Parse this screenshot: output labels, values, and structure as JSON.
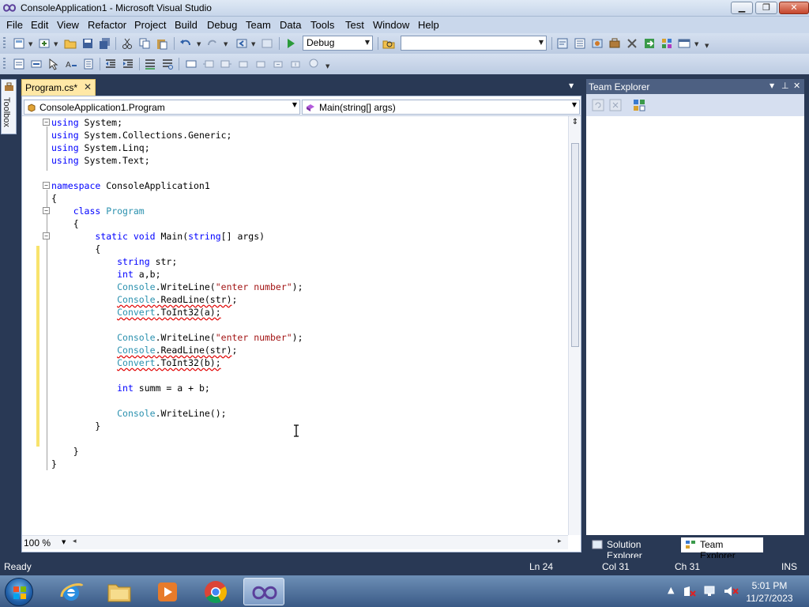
{
  "window": {
    "title": "ConsoleApplication1 - Microsoft Visual Studio",
    "minimize": "▁",
    "maximize": "❐",
    "close": "✕"
  },
  "menu": [
    "File",
    "Edit",
    "View",
    "Refactor",
    "Project",
    "Build",
    "Debug",
    "Team",
    "Data",
    "Tools",
    "Test",
    "Window",
    "Help"
  ],
  "toolbar": {
    "config_value": "Debug",
    "platform_value": ""
  },
  "toolbox_label": "Toolbox",
  "doc_tab": {
    "label": "Program.cs*",
    "close": "✕"
  },
  "nav": {
    "type_value": "ConsoleApplication1.Program",
    "member_value": "Main(string[] args)"
  },
  "code": {
    "l1": [
      "using",
      " System;"
    ],
    "l2": [
      "using",
      " System.Collections.Generic;"
    ],
    "l3": [
      "using",
      " System.Linq;"
    ],
    "l4": [
      "using",
      " System.Text;"
    ],
    "l6": [
      "namespace",
      " ConsoleApplication1"
    ],
    "l7": "{",
    "l8": [
      "    ",
      "class",
      " ",
      "Program"
    ],
    "l9": "    {",
    "l10": [
      "        ",
      "static",
      " ",
      "void",
      " Main(",
      "string",
      "[] args)"
    ],
    "l11": "        {",
    "l12": [
      "            ",
      "string",
      " str;"
    ],
    "l13": [
      "            ",
      "int",
      " a,b;"
    ],
    "l14": [
      "            ",
      "Console",
      ".WriteLine(",
      "\"enter number\"",
      ");"
    ],
    "l15": [
      "            ",
      "Console",
      ".ReadLine(str)",
      ";"
    ],
    "l16": [
      "            ",
      "Convert",
      ".ToInt32(a);"
    ],
    "l18": [
      "            ",
      "Console",
      ".WriteLine(",
      "\"enter number\"",
      ");"
    ],
    "l19": [
      "            ",
      "Console",
      ".ReadLine(str)",
      ";"
    ],
    "l20": [
      "            ",
      "Convert",
      ".ToInt32(b);"
    ],
    "l22": [
      "            ",
      "int",
      " summ = a + b;"
    ],
    "l24": [
      "            ",
      "Console",
      ".WriteLine();"
    ],
    "l25": "        }",
    "l27": "    }",
    "l28": "}"
  },
  "editor": {
    "zoom": "100 %"
  },
  "team_explorer": {
    "title": "Team Explorer"
  },
  "bottom_tabs": [
    "Solution Explorer",
    "Team Explorer"
  ],
  "status": {
    "ready": "Ready",
    "ln": "Ln 24",
    "col": "Col 31",
    "ch": "Ch 31",
    "mode": "INS"
  },
  "clock": {
    "time": "5:01 PM",
    "date": "11/27/2023"
  },
  "colors": {
    "keyword": "#0000ff",
    "type": "#2b91af",
    "string": "#a31515",
    "vs_blue": "#293955",
    "active_tab": "#ffe8a6",
    "change_bar": "#f8e36c"
  }
}
